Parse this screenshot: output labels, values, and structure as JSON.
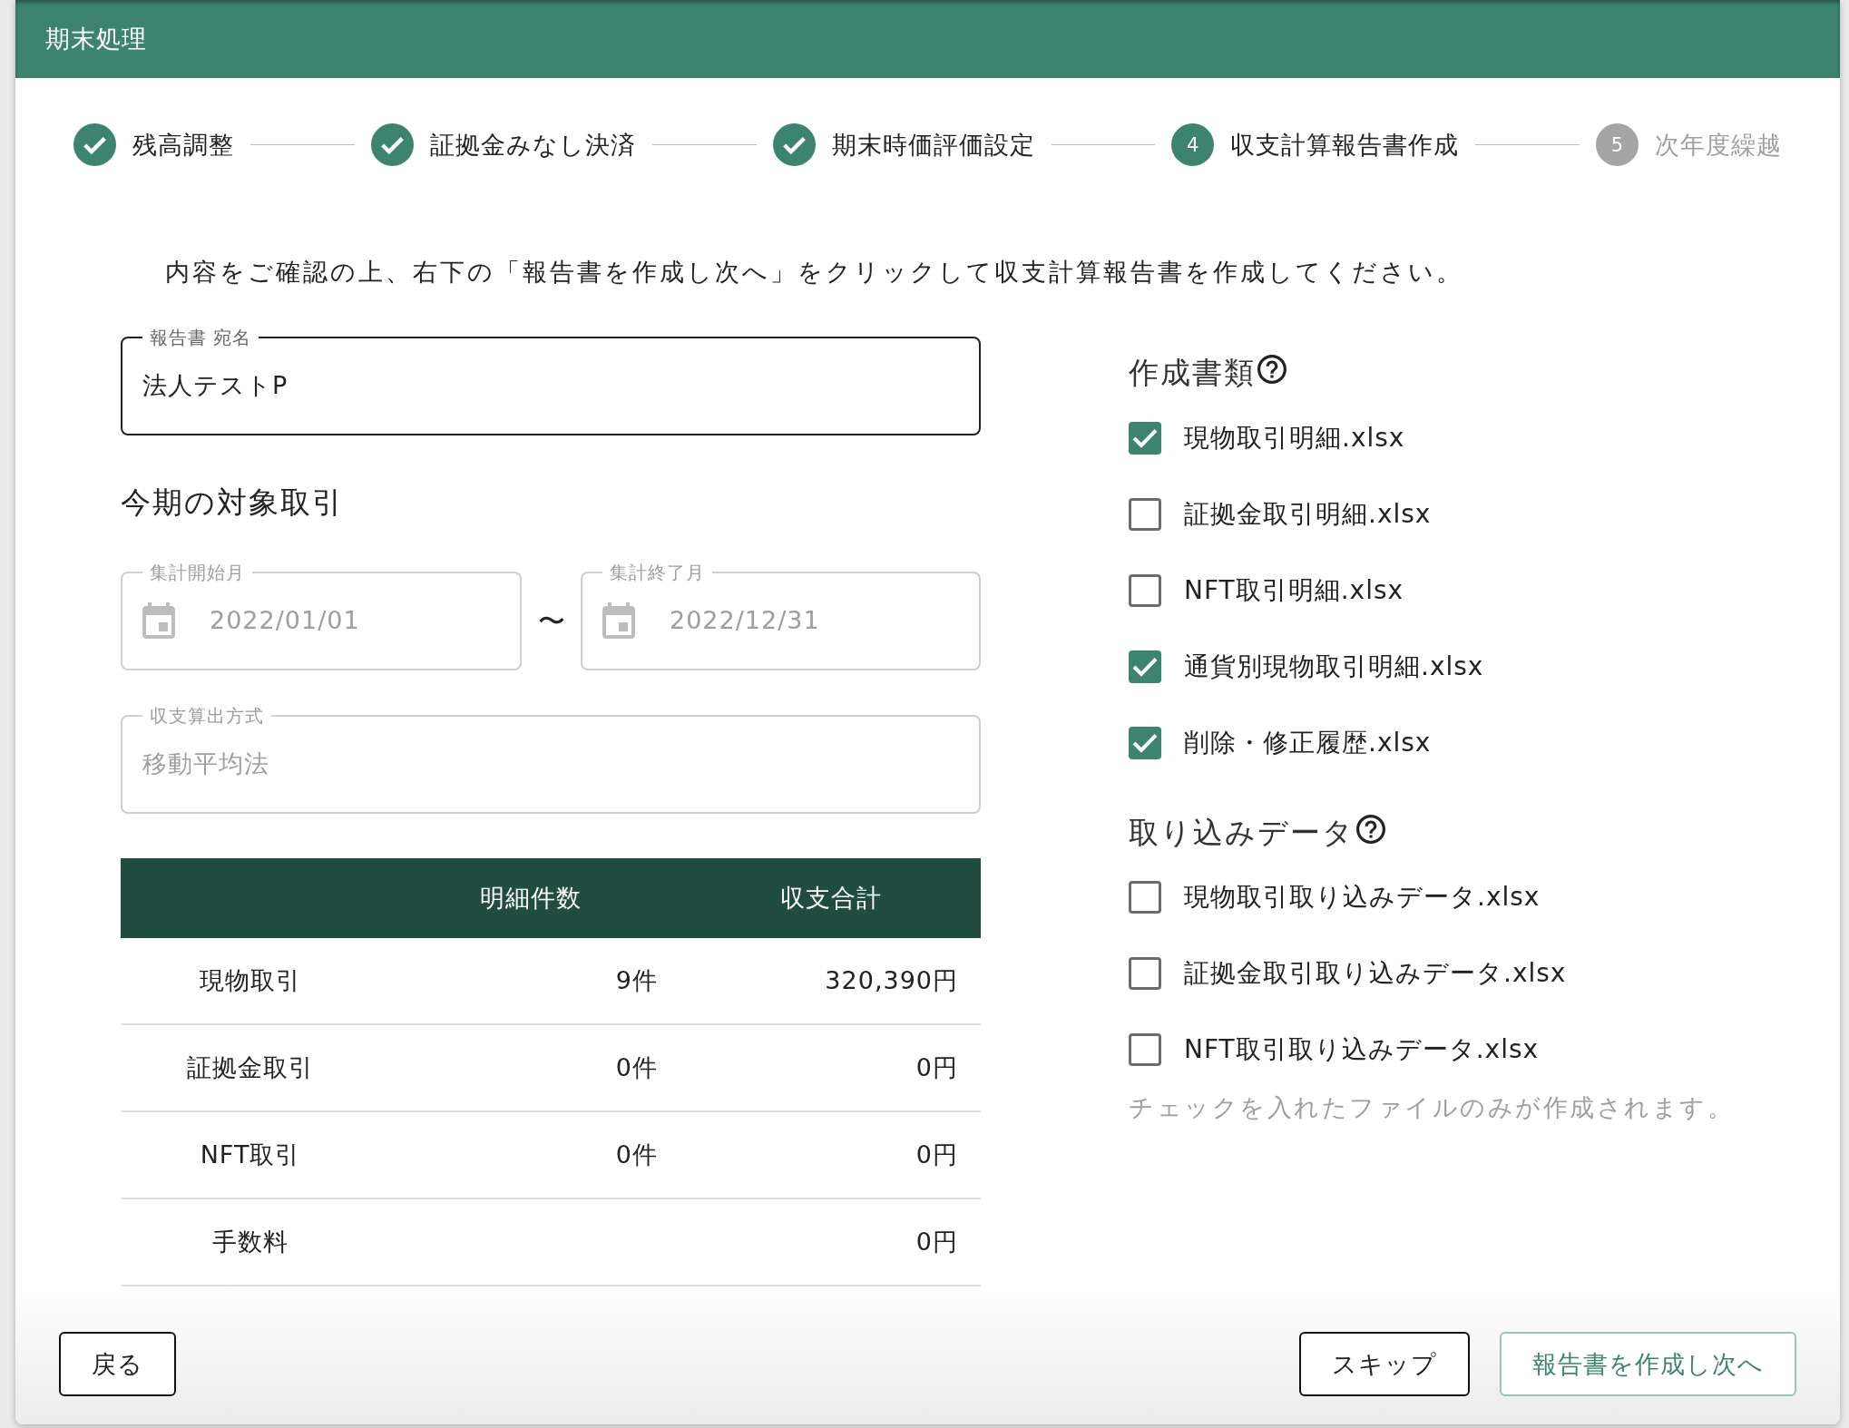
{
  "header": {
    "title": "期末処理"
  },
  "stepper": [
    {
      "label": "残高調整",
      "kind": "done"
    },
    {
      "label": "証拠金みなし決済",
      "kind": "done"
    },
    {
      "label": "期末時価評価設定",
      "kind": "done"
    },
    {
      "number": "4",
      "label": "収支計算報告書作成",
      "kind": "active"
    },
    {
      "number": "5",
      "label": "次年度繰越",
      "kind": "pending"
    }
  ],
  "instruction": "内容をご確認の上、右下の「報告書を作成し次へ」をクリックして収支計算報告書を作成してください。",
  "recipient_field": {
    "label": "報告書 宛名",
    "value": "法人テストP",
    "disabled": false
  },
  "period": {
    "heading": "今期の対象取引",
    "start_field": {
      "label": "集計開始月",
      "value": "2022/01/01",
      "disabled": true
    },
    "separator": "〜",
    "end_field": {
      "label": "集計終了月",
      "value": "2022/12/31",
      "disabled": true
    },
    "method_field": {
      "label": "収支算出方式",
      "value": "移動平均法",
      "disabled": true
    }
  },
  "summary_table": {
    "columns": [
      "明細件数",
      "収支合計"
    ],
    "rows": [
      {
        "label": "現物取引",
        "count": "9件",
        "total": "320,390円"
      },
      {
        "label": "証拠金取引",
        "count": "0件",
        "total": "0円"
      },
      {
        "label": "NFT取引",
        "count": "0件",
        "total": "0円"
      },
      {
        "label": "手数料",
        "total": "0円"
      }
    ]
  },
  "documents": {
    "heading": "作成書類",
    "items": [
      {
        "label": "現物取引明細.xlsx",
        "checked": true
      },
      {
        "label": "証拠金取引明細.xlsx",
        "checked": false
      },
      {
        "label": "NFT取引明細.xlsx",
        "checked": false
      },
      {
        "label": "通貨別現物取引明細.xlsx",
        "checked": true
      },
      {
        "label": "削除・修正履歴.xlsx",
        "checked": true
      }
    ]
  },
  "import_data": {
    "heading": "取り込みデータ",
    "items": [
      {
        "label": "現物取引取り込みデータ.xlsx",
        "checked": false
      },
      {
        "label": "証拠金取引取り込みデータ.xlsx",
        "checked": false
      },
      {
        "label": "NFT取引取り込みデータ.xlsx",
        "checked": false
      }
    ]
  },
  "note": "チェックを入れたファイルのみが作成されます。",
  "footer": {
    "left_buttons": [
      {
        "label": "戻る",
        "kind": "default"
      }
    ],
    "right_buttons": [
      {
        "label": "スキップ",
        "kind": "default"
      },
      {
        "label": "報告書を作成し次へ",
        "kind": "primary"
      }
    ]
  }
}
